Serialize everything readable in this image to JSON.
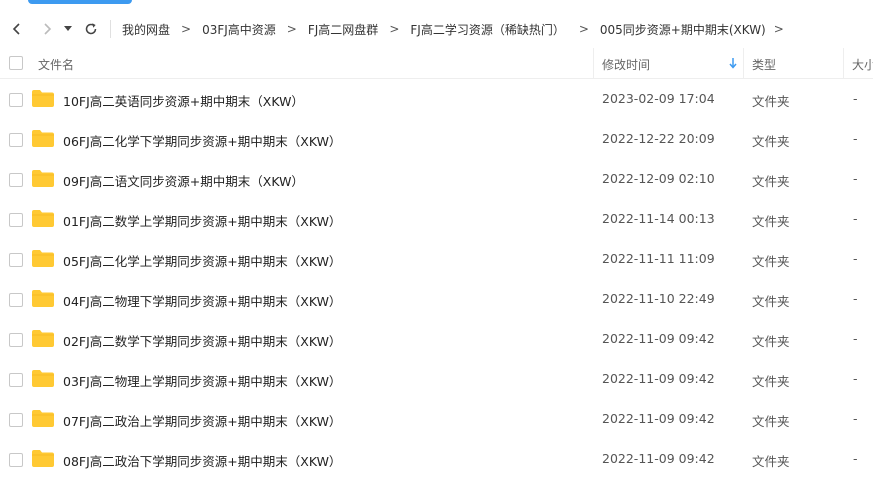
{
  "toolbar": {
    "back_icon": "chevron-left-icon",
    "forward_icon": "chevron-right-icon",
    "history_icon": "caret-down-icon",
    "refresh_icon": "refresh-icon"
  },
  "breadcrumb": [
    "我的网盘",
    "03FJ高中资源",
    "FJ高二网盘群",
    "FJ高二学习资源（稀缺热门）",
    "005同步资源+期中期末(XKW)"
  ],
  "breadcrumb_separator": ">",
  "columns": {
    "name": "文件名",
    "modified": "修改时间",
    "type": "类型",
    "size": "大小"
  },
  "sort": {
    "column": "modified",
    "direction": "descending",
    "icon": "arrow-down-icon"
  },
  "colors": {
    "accent": "#3d9af0",
    "folder": "#ffc933"
  },
  "files": [
    {
      "name": "10FJ高二英语同步资源+期中期末（XKW）",
      "modified": "2023-02-09 17:04",
      "type": "文件夹",
      "size": "-"
    },
    {
      "name": "06FJ高二化学下学期同步资源+期中期末（XKW）",
      "modified": "2022-12-22 20:09",
      "type": "文件夹",
      "size": "-"
    },
    {
      "name": "09FJ高二语文同步资源+期中期末（XKW）",
      "modified": "2022-12-09 02:10",
      "type": "文件夹",
      "size": "-"
    },
    {
      "name": "01FJ高二数学上学期同步资源+期中期末（XKW）",
      "modified": "2022-11-14 00:13",
      "type": "文件夹",
      "size": "-"
    },
    {
      "name": "05FJ高二化学上学期同步资源+期中期末（XKW）",
      "modified": "2022-11-11 11:09",
      "type": "文件夹",
      "size": "-"
    },
    {
      "name": "04FJ高二物理下学期同步资源+期中期末（XKW）",
      "modified": "2022-11-10 22:49",
      "type": "文件夹",
      "size": "-"
    },
    {
      "name": "02FJ高二数学下学期同步资源+期中期末（XKW）",
      "modified": "2022-11-09 09:42",
      "type": "文件夹",
      "size": "-"
    },
    {
      "name": "03FJ高二物理上学期同步资源+期中期末（XKW）",
      "modified": "2022-11-09 09:42",
      "type": "文件夹",
      "size": "-"
    },
    {
      "name": "07FJ高二政治上学期同步资源+期中期末（XKW）",
      "modified": "2022-11-09 09:42",
      "type": "文件夹",
      "size": "-"
    },
    {
      "name": "08FJ高二政治下学期同步资源+期中期末（XKW）",
      "modified": "2022-11-09 09:42",
      "type": "文件夹",
      "size": "-"
    }
  ]
}
